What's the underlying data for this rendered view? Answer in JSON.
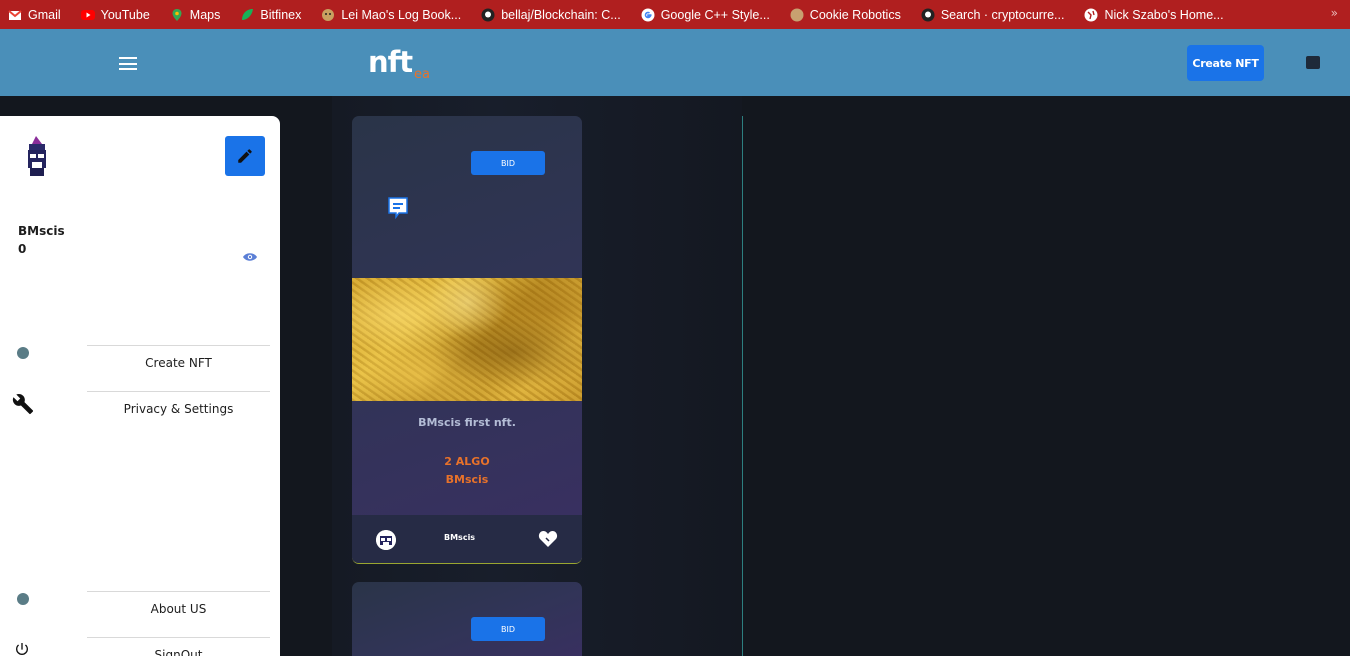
{
  "bookmarks": [
    {
      "label": "Gmail",
      "icon": "gmail-icon",
      "color": "#ea4335"
    },
    {
      "label": "YouTube",
      "icon": "youtube-icon",
      "color": "#ff0000"
    },
    {
      "label": "Maps",
      "icon": "maps-icon",
      "color": "#34a853"
    },
    {
      "label": "Bitfinex",
      "icon": "bitfinex-icon",
      "color": "#16b157"
    },
    {
      "label": "Lei Mao's Log Book...",
      "icon": "leimao-icon",
      "color": "#c8a060"
    },
    {
      "label": "bellaj/Blockchain: C...",
      "icon": "github-icon",
      "color": "#222222"
    },
    {
      "label": "Google C++ Style...",
      "icon": "google-icon",
      "color": "#ffffff"
    },
    {
      "label": "Cookie Robotics",
      "icon": "cookie-icon",
      "color": "#c8a070"
    },
    {
      "label": "Search · cryptocurre...",
      "icon": "github-icon",
      "color": "#222222"
    },
    {
      "label": "Nick Szabo's Home...",
      "icon": "globe-icon",
      "color": "#ffffff"
    }
  ],
  "bookmarks_more": "»",
  "header": {
    "logo": "nft",
    "logo_sub": "ea",
    "create_label": "Create NFT"
  },
  "sidebar": {
    "username": "BMscis",
    "count": "0",
    "items": [
      {
        "label": "Create NFT"
      },
      {
        "label": "Privacy & Settings"
      },
      {
        "label": "About US"
      },
      {
        "label": "SignOut"
      }
    ]
  },
  "cards": [
    {
      "bid_label": "BID",
      "title": "BMscis first nft.",
      "price": "2 ALGO",
      "owner": "BMscis",
      "footer_name": "BMscis"
    },
    {
      "bid_label": "BID"
    }
  ],
  "colors": {
    "bookmarks_bg": "#b01f1f",
    "header_bg": "#4a8fb9",
    "accent": "#1a73e8",
    "price": "#e8722a",
    "page_bg": "#13171e"
  }
}
